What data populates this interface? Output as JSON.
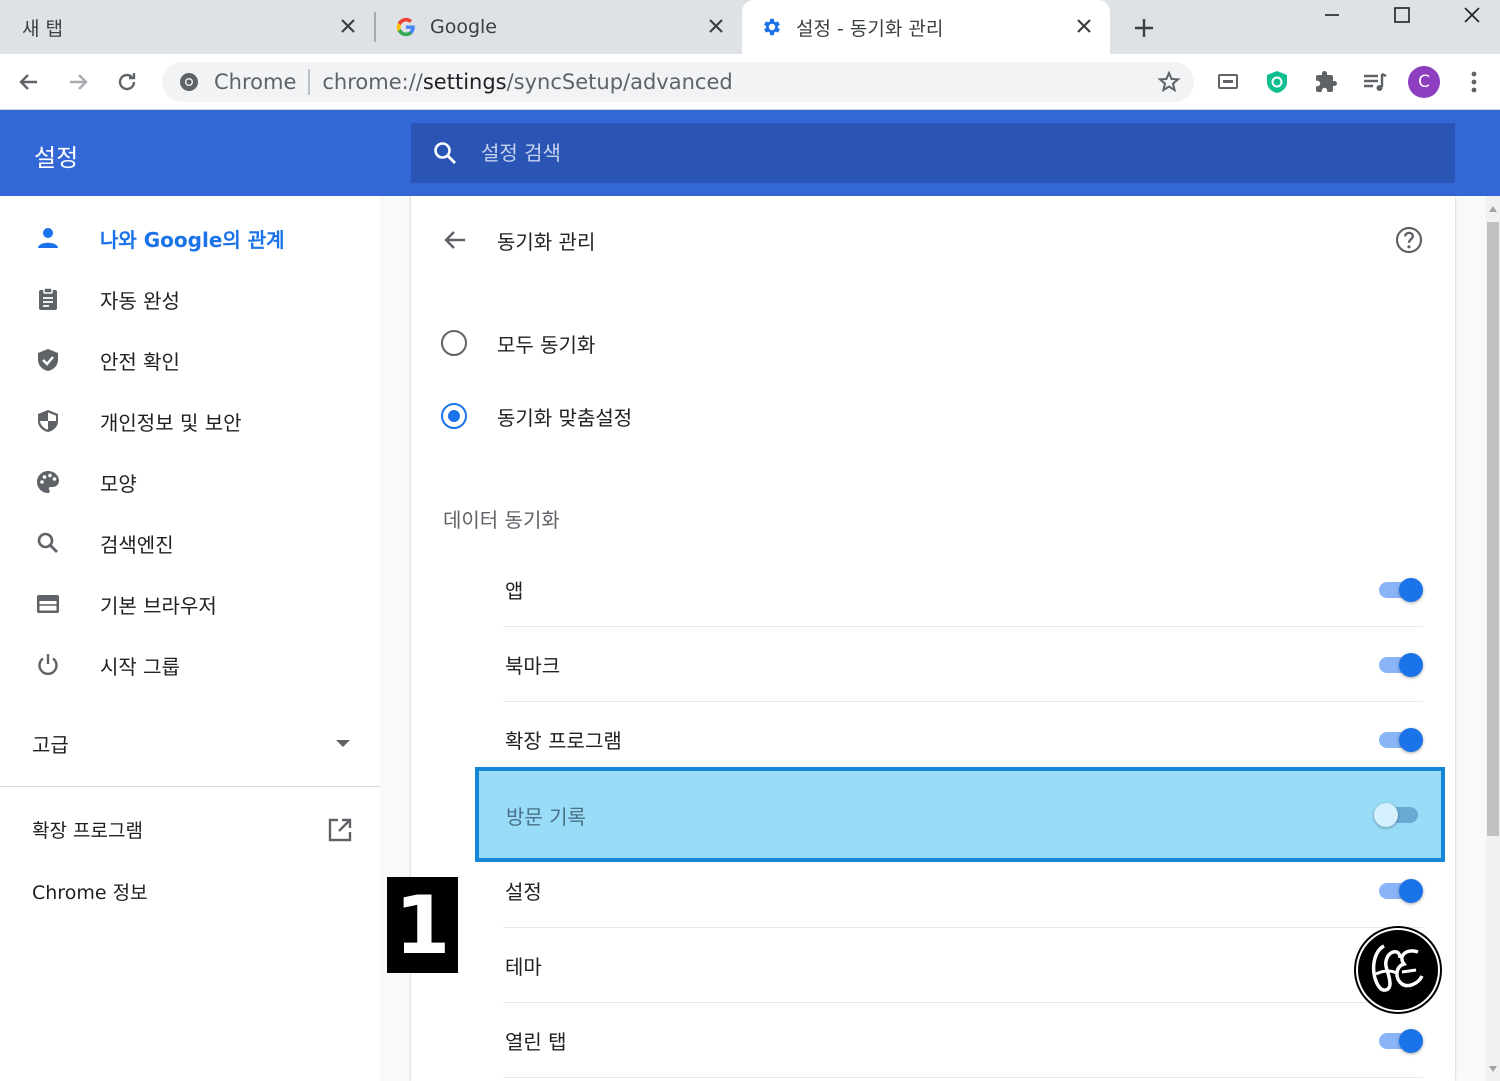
{
  "tabs": [
    {
      "title": "새 탭",
      "icon": "none"
    },
    {
      "title": "Google",
      "icon": "google-icon"
    },
    {
      "title": "설정 - 동기화 관리",
      "icon": "gear-icon",
      "active": true
    }
  ],
  "omnibox": {
    "site_label": "Chrome",
    "url_prefix": "chrome://",
    "url_path": "settings",
    "url_suffix": "/syncSetup/advanced"
  },
  "profile_initial": "C",
  "settings_header": {
    "title": "설정",
    "search_placeholder": "설정 검색"
  },
  "sidebar": {
    "items": [
      {
        "label": "나와 Google의 관계",
        "icon": "person-icon",
        "selected": true
      },
      {
        "label": "자동 완성",
        "icon": "clipboard-icon"
      },
      {
        "label": "안전 확인",
        "icon": "shield-check-icon"
      },
      {
        "label": "개인정보 및 보안",
        "icon": "shield-icon"
      },
      {
        "label": "모양",
        "icon": "palette-icon"
      },
      {
        "label": "검색엔진",
        "icon": "search-icon"
      },
      {
        "label": "기본 브라우저",
        "icon": "browser-icon"
      },
      {
        "label": "시작 그룹",
        "icon": "power-icon"
      }
    ],
    "advanced_label": "고급",
    "extensions_label": "확장 프로그램",
    "about_label": "Chrome 정보"
  },
  "main": {
    "page_title": "동기화 관리",
    "radio_options": [
      {
        "label": "모두 동기화",
        "checked": false
      },
      {
        "label": "동기화 맞춤설정",
        "checked": true
      }
    ],
    "section_title": "데이터 동기화",
    "sync_items": [
      {
        "label": "앱",
        "enabled": true
      },
      {
        "label": "북마크",
        "enabled": true
      },
      {
        "label": "확장 프로그램",
        "enabled": true
      },
      {
        "label": "방문 기록",
        "enabled": false,
        "highlighted": true
      },
      {
        "label": "설정",
        "enabled": true
      },
      {
        "label": "테마",
        "enabled": true
      },
      {
        "label": "열린 탭",
        "enabled": true
      }
    ]
  },
  "overlay": {
    "step_number": "1"
  },
  "colors": {
    "header_blue": "#3367d6",
    "search_blue": "#2b55b4",
    "accent": "#1a73e8",
    "highlight_fill": "#87d6f7",
    "highlight_border": "#1687d6"
  }
}
